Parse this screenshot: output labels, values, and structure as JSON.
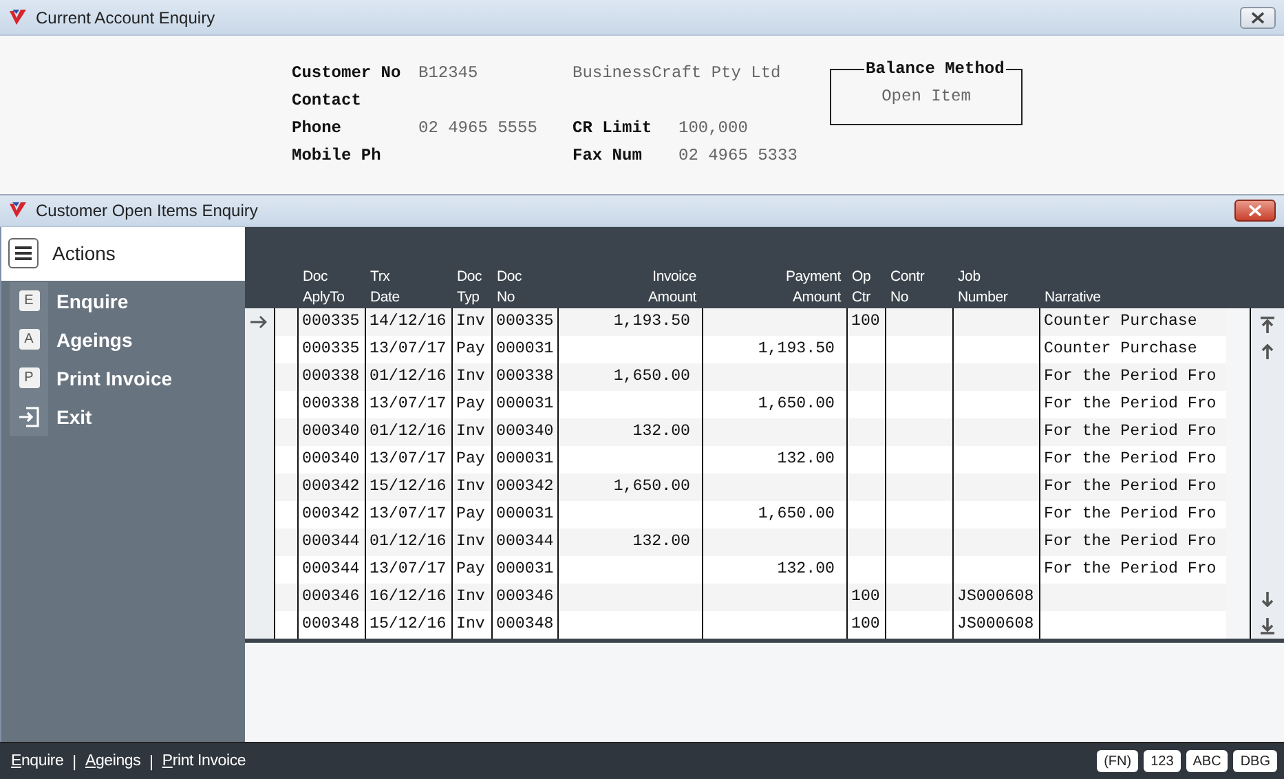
{
  "account_window": {
    "title": "Current Account Enquiry",
    "fields": [
      {
        "label": "Customer No",
        "value": "B12345",
        "extra": "BusinessCraft Pty Ltd"
      },
      {
        "label": "Contact"
      },
      {
        "label": "Phone",
        "value": "02 4965 5555",
        "label2": "CR Limit",
        "value2": "100,000"
      },
      {
        "label": "Mobile Ph",
        "label2": "Fax Num",
        "value2": "02 4965 5333"
      }
    ],
    "balance_method": {
      "legend": "Balance Method",
      "value": "Open Item"
    }
  },
  "items_window": {
    "title": "Customer Open Items Enquiry"
  },
  "sidebar": {
    "title": "Actions",
    "items": [
      {
        "kind": "letter",
        "key": "E",
        "label": "Enquire"
      },
      {
        "kind": "letter",
        "key": "A",
        "label": "Ageings"
      },
      {
        "kind": "letter",
        "key": "P",
        "label": "Print Invoice"
      },
      {
        "kind": "exit",
        "label": "Exit"
      }
    ]
  },
  "table": {
    "columns": [
      {
        "label": [
          "Doc",
          "AplyTo"
        ],
        "kind": "text"
      },
      {
        "label": [
          "Trx",
          "Date"
        ],
        "kind": "text"
      },
      {
        "label": [
          "Doc",
          "Typ"
        ],
        "kind": "text"
      },
      {
        "label": [
          "Doc",
          "No"
        ],
        "kind": "text"
      },
      {
        "label": [
          "Invoice",
          "Amount"
        ],
        "kind": "amount"
      },
      {
        "label": [
          "Payment",
          "Amount"
        ],
        "kind": "amount"
      },
      {
        "label": [
          "Op",
          "Ctr"
        ],
        "kind": "text"
      },
      {
        "label": [
          "Contr",
          "No"
        ],
        "kind": "text"
      },
      {
        "label": [
          "Job",
          "Number"
        ],
        "kind": "text"
      },
      {
        "label": [
          "Narrative"
        ],
        "kind": "text"
      }
    ],
    "rows": [
      {
        "current": true,
        "cells": [
          "000335",
          "14/12/16",
          "Inv",
          "000335",
          "1,193.50",
          null,
          "100",
          null,
          null,
          "Counter Purchase"
        ]
      },
      {
        "current": false,
        "cells": [
          "000335",
          "13/07/17",
          "Pay",
          "000031",
          null,
          "1,193.50",
          null,
          null,
          null,
          "Counter Purchase"
        ]
      },
      {
        "current": false,
        "cells": [
          "000338",
          "01/12/16",
          "Inv",
          "000338",
          "1,650.00",
          null,
          null,
          null,
          null,
          "For the Period Fro"
        ]
      },
      {
        "current": false,
        "cells": [
          "000338",
          "13/07/17",
          "Pay",
          "000031",
          null,
          "1,650.00",
          null,
          null,
          null,
          "For the Period Fro"
        ]
      },
      {
        "current": false,
        "cells": [
          "000340",
          "01/12/16",
          "Inv",
          "000340",
          "132.00",
          null,
          null,
          null,
          null,
          "For the Period Fro"
        ]
      },
      {
        "current": false,
        "cells": [
          "000340",
          "13/07/17",
          "Pay",
          "000031",
          null,
          "132.00",
          null,
          null,
          null,
          "For the Period Fro"
        ]
      },
      {
        "current": false,
        "cells": [
          "000342",
          "15/12/16",
          "Inv",
          "000342",
          "1,650.00",
          null,
          null,
          null,
          null,
          "For the Period Fro"
        ]
      },
      {
        "current": false,
        "cells": [
          "000342",
          "13/07/17",
          "Pay",
          "000031",
          null,
          "1,650.00",
          null,
          null,
          null,
          "For the Period Fro"
        ]
      },
      {
        "current": false,
        "cells": [
          "000344",
          "01/12/16",
          "Inv",
          "000344",
          "132.00",
          null,
          null,
          null,
          null,
          "For the Period Fro"
        ]
      },
      {
        "current": false,
        "cells": [
          "000344",
          "13/07/17",
          "Pay",
          "000031",
          null,
          "132.00",
          null,
          null,
          null,
          "For the Period Fro"
        ]
      },
      {
        "current": false,
        "cells": [
          "000346",
          "16/12/16",
          "Inv",
          "000346",
          null,
          null,
          "100",
          null,
          "JS000608",
          null
        ]
      },
      {
        "current": false,
        "cells": [
          "000348",
          "15/12/16",
          "Inv",
          "000348",
          null,
          null,
          "100",
          null,
          "JS000608",
          null
        ]
      }
    ]
  },
  "status_bar": {
    "links": [
      "Enquire",
      "Ageings",
      "Print Invoice"
    ],
    "separator": "|",
    "badges": [
      "(FN)",
      "123",
      "ABC",
      "DBG"
    ]
  }
}
